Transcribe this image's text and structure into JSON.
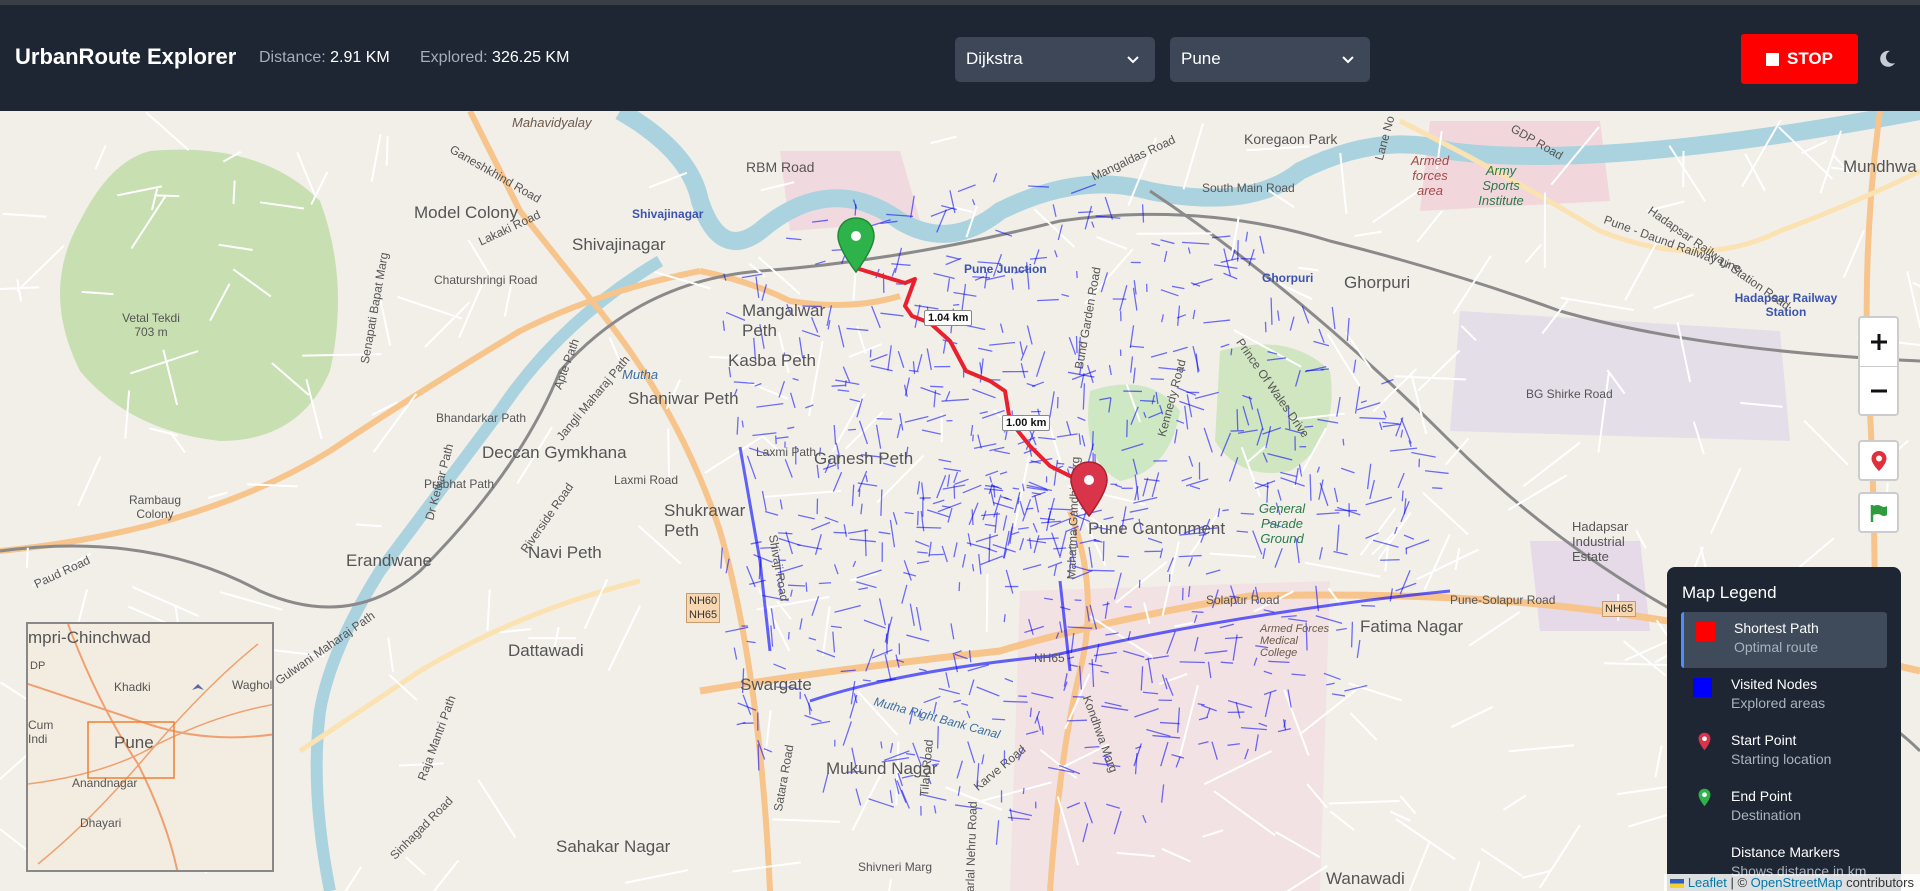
{
  "app": {
    "title": "UrbanRoute Explorer"
  },
  "stats": {
    "distance_label": "Distance:",
    "distance_value": "2.91 KM",
    "explored_label": "Explored:",
    "explored_value": "326.25 KM"
  },
  "controls": {
    "algorithm": "Dijkstra",
    "city": "Pune",
    "stop_label": "STOP"
  },
  "map": {
    "labels": [
      "Mahavidyalay",
      "Koregaon Park",
      "RBM Road",
      "Mangaldas Road",
      "South Main Road",
      "Model Colony",
      "Shivajinagar",
      "Shivajinagar",
      "Pune Junction",
      "Ghorpuri",
      "Ghorpuri",
      "Mangalwar Peth",
      "Kasba Peth",
      "Shaniwar Peth",
      "Deccan Gymkhana",
      "Ganesh Peth",
      "Shukrawar Peth",
      "Pune Cantonment",
      "Erandwane",
      "Navi Peth",
      "Swargate",
      "Mukund Nagar",
      "Sahakar Nagar",
      "Dattawadi",
      "Fatima Nagar",
      "Wanawadi",
      "Mundhwa",
      "Hadapsar Railway Station",
      "Hadapsar Industrial Estate",
      "Vetal Tekdi 703 m",
      "Rambaug Colony",
      "Armed forces area",
      "Army Sports Institute",
      "General Parade Ground",
      "Armed Forces Medical College",
      "Pune-Solapur Road",
      "Solapur Road",
      "BG Shirke Road",
      "Pune - Daund Railway Line",
      "Hadapsar Railway Station Road",
      "GDP Road",
      "Lane No",
      "Senapati Bapat Marg",
      "Ganeshkhind Road",
      "Lakaki Road",
      "Chaturshringi Road",
      "Bhandarkar Path",
      "Dr Ketkar Path",
      "Prabhat Path",
      "Laxmi Path",
      "Laxmi Road",
      "Jangli Maharaj Path",
      "Apte Path",
      "Riverside Road",
      "Paud Road",
      "Shivaji Road",
      "Satara Road",
      "Karve Road",
      "Gulwani Maharaj Path",
      "Raja Mantri Path",
      "Sinhagad Road",
      "Shivneri Marg",
      "Mahatma Gandhi Marg",
      "Bund Garden Road",
      "Kennedy Road",
      "Prince Of Wales Drive",
      "Mutha",
      "Mutha Right Bank Canal",
      "Tilak Road",
      "Jawaharlal Nehru Road",
      "Kondhwa Marg",
      "NH65",
      "NH60 NH65",
      "NH65"
    ],
    "distance_markers": [
      "1.04 km",
      "1.00 km"
    ],
    "minimap_labels": [
      "mpri-Chinchwad",
      "Khadki",
      "Waghol",
      "Pune",
      "Anandnagar",
      "Dhayari",
      "Cum",
      "Indi",
      "DP"
    ],
    "start_marker": "start-point",
    "end_marker": "end-point"
  },
  "legend": {
    "title": "Map Legend",
    "items": [
      {
        "name": "Shortest Path",
        "desc": "Optimal route",
        "color": "#ff0000",
        "icon": "square"
      },
      {
        "name": "Visited Nodes",
        "desc": "Explored areas",
        "color": "#0000ff",
        "icon": "square"
      },
      {
        "name": "Start Point",
        "desc": "Starting location",
        "color": "#d9344a",
        "icon": "pin"
      },
      {
        "name": "End Point",
        "desc": "Destination",
        "color": "#2db34a",
        "icon": "pin"
      },
      {
        "name": "Distance Markers",
        "desc": "Shows distance in km",
        "color": "",
        "icon": "none"
      }
    ]
  },
  "attribution": {
    "leaflet": "Leaflet",
    "sep": " | © ",
    "osm": "OpenStreetMap",
    "suffix": " contributors"
  },
  "colors": {
    "header_bg": "#1e2633",
    "stop": "#ff0000",
    "route": "#ff0000",
    "visited": "#0000ff"
  }
}
